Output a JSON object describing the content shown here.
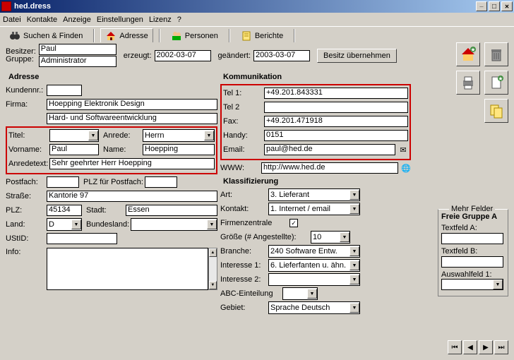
{
  "window": {
    "title": "hed.dress"
  },
  "menu": {
    "datei": "Datei",
    "kontakte": "Kontakte",
    "anzeige": "Anzeige",
    "einstellungen": "Einstellungen",
    "lizenz": "Lizenz",
    "help": "?"
  },
  "tabs": {
    "search": "Suchen & Finden",
    "address": "Adresse",
    "persons": "Personen",
    "reports": "Berichte"
  },
  "header": {
    "besitzer_lbl": "Besitzer:",
    "gruppe_lbl": "Gruppe:",
    "besitzer": "Paul",
    "gruppe": "Administrator",
    "erzeugt_lbl": "erzeugt:",
    "erzeugt": "2002-03-07",
    "geaendert_lbl": "geändert:",
    "geaendert": "2003-03-07",
    "besitz_btn": "Besitz übernehmen"
  },
  "adresse": {
    "title": "Adresse",
    "kundennr_lbl": "Kundennr.:",
    "kundennr": "",
    "firma_lbl": "Firma:",
    "firma1": "Hoepping Elektronik Design",
    "firma2": "Hard- und Softwareentwicklung",
    "titel_lbl": "Titel:",
    "titel": "",
    "anrede_lbl": "Anrede:",
    "anrede": "Herrn",
    "vorname_lbl": "Vorname:",
    "vorname": "Paul",
    "name_lbl": "Name:",
    "name": "Hoepping",
    "anredetext_lbl": "Anredetext:",
    "anredetext": "Sehr geehrter Herr Hoepping",
    "postfach_lbl": "Postfach:",
    "postfach": "",
    "plzpostfach_lbl": "PLZ für Postfach:",
    "plzpostfach": "",
    "strasse_lbl": "Straße:",
    "strasse": "Kantorie 97",
    "plz_lbl": "PLZ:",
    "plz": "45134",
    "stadt_lbl": "Stadt:",
    "stadt": "Essen",
    "land_lbl": "Land:",
    "land": "D",
    "bundesland_lbl": "Bundesland:",
    "bundesland": "",
    "ustid_lbl": "UStID:",
    "ustid": "",
    "info_lbl": "Info:"
  },
  "komm": {
    "title": "Kommunikation",
    "tel1_lbl": "Tel 1:",
    "tel1": "+49.201.843331",
    "tel2_lbl": "Tel 2",
    "tel2": "",
    "fax_lbl": "Fax:",
    "fax": "+49.201.471918",
    "handy_lbl": "Handy:",
    "handy": "0151",
    "email_lbl": "Email:",
    "email": "paul@hed.de",
    "www_lbl": "WWW:",
    "www": "http://www.hed.de"
  },
  "klass": {
    "title": "Klassifizierung",
    "art_lbl": "Art:",
    "art": "3. Lieferant",
    "kontakt_lbl": "Kontakt:",
    "kontakt": "1. Internet / email",
    "firmenz_lbl": "Firmenzentrale",
    "firmenz": true,
    "groesse_lbl": "Größe (# Angestellte):",
    "groesse": "10",
    "branche_lbl": "Branche:",
    "branche": "240 Software Entw.",
    "int1_lbl": "Interesse 1:",
    "int1": "6. Lieferfanten u. ähn.",
    "int2_lbl": "Interesse 2:",
    "int2": "",
    "abc_lbl": "ABC-Einteilung",
    "abc": "",
    "gebiet_lbl": "Gebiet:",
    "gebiet": "Sprache Deutsch"
  },
  "mehr": {
    "title": "Mehr Felder",
    "gruppe": "Freie Gruppe A",
    "ta_lbl": "Textfeld A:",
    "tb_lbl": "Textfeld B:",
    "aw_lbl": "Auswahlfeld 1:"
  }
}
